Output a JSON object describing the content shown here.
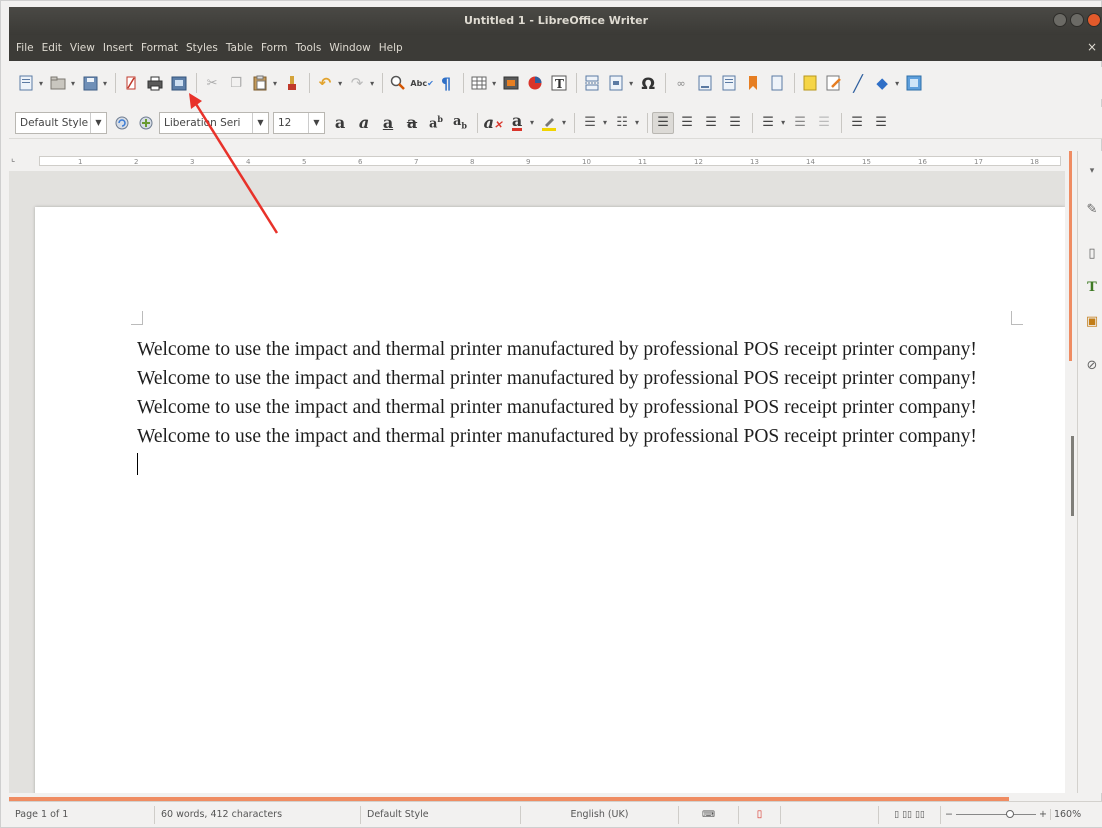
{
  "window": {
    "title": "Untitled 1 - LibreOffice Writer",
    "doc_close_glyph": "×"
  },
  "menu": [
    "File",
    "Edit",
    "View",
    "Insert",
    "Format",
    "Styles",
    "Table",
    "Form",
    "Tools",
    "Window",
    "Help"
  ],
  "formatting_toolbar": {
    "paragraph_style": "Default Style",
    "font_name": "Liberation Seri",
    "font_size": "12"
  },
  "ruler": {
    "ticks": [
      "1",
      "2",
      "3",
      "4",
      "5",
      "6",
      "7",
      "8",
      "9",
      "10",
      "11",
      "12",
      "13",
      "14",
      "15",
      "16",
      "17",
      "18"
    ]
  },
  "document": {
    "paragraphs": [
      "Welcome to use the impact and thermal printer manufactured by professional POS receipt printer company!",
      "Welcome to use the impact and thermal printer manufactured by professional POS receipt printer company!",
      "Welcome to use the impact and thermal printer manufactured by professional POS receipt printer company!",
      "Welcome to use the impact and thermal printer manufactured by professional POS receipt printer company!"
    ]
  },
  "statusbar": {
    "page": "Page 1 of 1",
    "word_count": "60 words, 412 characters",
    "page_style": "Default Style",
    "language": "English (UK)",
    "zoom": "160%"
  },
  "annotation": {
    "color": "#e8322a",
    "target": "print-button"
  },
  "colors": {
    "titlebar": "#3c3b37",
    "accent": "#ef8c62",
    "page": "#ffffff"
  }
}
